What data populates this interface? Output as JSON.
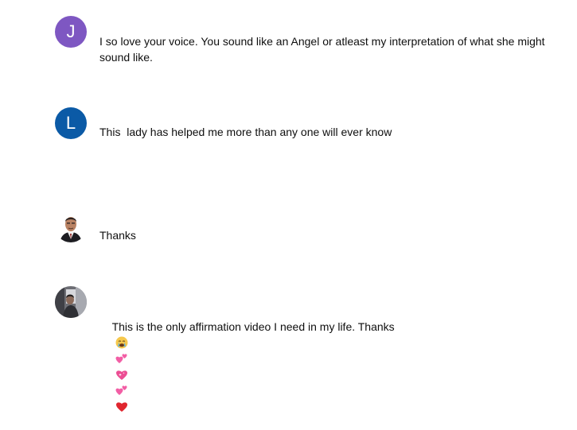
{
  "comments": [
    {
      "avatar_type": "letter",
      "avatar_letter": "J",
      "avatar_color": "#7e57c2",
      "text": "I so love your voice. You sound like an Angel or atleast my interpretation of what she might sound like."
    },
    {
      "avatar_type": "letter",
      "avatar_letter": "L",
      "avatar_color": "#0b5aa6",
      "text": "This  lady has helped me more than any one will ever know"
    },
    {
      "avatar_type": "photo",
      "avatar_icon": "man-portrait-photo",
      "text": "Thanks"
    },
    {
      "avatar_type": "photo",
      "avatar_icon": "person-photo",
      "text": "This is the only affirmation video I need in my life. Thanks",
      "emojis": [
        "crying-face",
        "two-hearts",
        "sparkling-heart",
        "two-hearts",
        "red-heart"
      ]
    }
  ]
}
